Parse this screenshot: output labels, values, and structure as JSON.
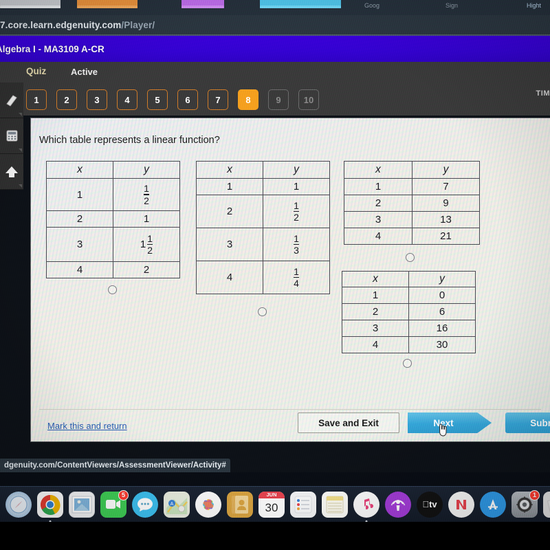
{
  "browser": {
    "url_bold": "7.core.learn.edgenuity.com",
    "url_dim": "/Player/",
    "status_url": "dgenuity.com/ContentViewers/AssessmentViewer/Activity#",
    "tabs": [
      {
        "name": "tab-1",
        "color": "#c9ccd1"
      },
      {
        "name": "tab-2",
        "color": "#e8913c"
      },
      {
        "name": "tab-3",
        "color": "#bc6ce8"
      },
      {
        "name": "tab-4",
        "color": "#4fc3e8"
      }
    ],
    "right_tab_labels": [
      "Goog",
      "Sign",
      "Hight"
    ]
  },
  "course": {
    "title": "Algebra I - MA3109 A-CR"
  },
  "nav": {
    "quiz_label": "Quiz",
    "status_label": "Active",
    "timer_label": "TIM",
    "questions": [
      {
        "label": "1",
        "state": "visited"
      },
      {
        "label": "2",
        "state": "visited"
      },
      {
        "label": "3",
        "state": "visited"
      },
      {
        "label": "4",
        "state": "visited"
      },
      {
        "label": "5",
        "state": "visited"
      },
      {
        "label": "6",
        "state": "visited"
      },
      {
        "label": "7",
        "state": "visited"
      },
      {
        "label": "8",
        "state": "current"
      },
      {
        "label": "9",
        "state": "locked"
      },
      {
        "label": "10",
        "state": "locked"
      }
    ]
  },
  "rail": [
    {
      "name": "eraser-icon",
      "glyph": "╱"
    },
    {
      "name": "calculator-icon",
      "glyph": "▦"
    },
    {
      "name": "arrow-up-icon",
      "glyph": "↑"
    }
  ],
  "question": {
    "prompt": "Which table represents a linear function?",
    "options": [
      {
        "id": "option-a",
        "headers": [
          "x",
          "y"
        ],
        "rows": [
          {
            "x": "1",
            "y_type": "fraction",
            "y_num": "1",
            "y_den": "2"
          },
          {
            "x": "2",
            "y_type": "plain",
            "y": "1"
          },
          {
            "x": "3",
            "y_type": "mixed",
            "y_whole": "1",
            "y_num": "1",
            "y_den": "2"
          },
          {
            "x": "4",
            "y_type": "plain",
            "y": "2"
          }
        ]
      },
      {
        "id": "option-b",
        "headers": [
          "x",
          "y"
        ],
        "rows": [
          {
            "x": "1",
            "y_type": "plain",
            "y": "1"
          },
          {
            "x": "2",
            "y_type": "fraction",
            "y_num": "1",
            "y_den": "2"
          },
          {
            "x": "3",
            "y_type": "fraction",
            "y_num": "1",
            "y_den": "3"
          },
          {
            "x": "4",
            "y_type": "fraction",
            "y_num": "1",
            "y_den": "4"
          }
        ]
      },
      {
        "id": "option-c",
        "headers": [
          "x",
          "y"
        ],
        "rows": [
          {
            "x": "1",
            "y_type": "plain",
            "y": "7"
          },
          {
            "x": "2",
            "y_type": "plain",
            "y": "9"
          },
          {
            "x": "3",
            "y_type": "plain",
            "y": "13"
          },
          {
            "x": "4",
            "y_type": "plain",
            "y": "21"
          }
        ]
      },
      {
        "id": "option-d",
        "headers": [
          "x",
          "y"
        ],
        "rows": [
          {
            "x": "1",
            "y_type": "plain",
            "y": "0"
          },
          {
            "x": "2",
            "y_type": "plain",
            "y": "6"
          },
          {
            "x": "3",
            "y_type": "plain",
            "y": "16"
          },
          {
            "x": "4",
            "y_type": "plain",
            "y": "30"
          }
        ]
      }
    ]
  },
  "footer": {
    "mark_link": "Mark this and return",
    "save_label": "Save and Exit",
    "next_label": "Next",
    "submit_label": "Subm"
  },
  "dock": [
    {
      "name": "safari-icon",
      "label": "⦿",
      "bg": "#dfe7ef",
      "fg": "#2f7fd1",
      "round": true,
      "badge": "",
      "dot": false
    },
    {
      "name": "chrome-icon",
      "label": "◉",
      "bg": "#f7f7f7",
      "fg": "#2f7fd1",
      "round": false,
      "badge": "",
      "dot": true
    },
    {
      "name": "mail-icon",
      "label": "✉",
      "bg": "#e9edf2",
      "fg": "#5a7fa8",
      "round": false,
      "badge": "",
      "dot": false
    },
    {
      "name": "facetime-icon",
      "label": "▢",
      "bg": "#3fcc55",
      "fg": "#ffffff",
      "round": false,
      "badge": "5",
      "dot": false
    },
    {
      "name": "messages-icon",
      "label": "●●●",
      "bg": "#3dc0f0",
      "fg": "#ffffff",
      "round": true,
      "badge": "",
      "dot": false
    },
    {
      "name": "maps-icon",
      "label": "A",
      "bg": "#e8eadf",
      "fg": "#3b82d6",
      "round": false,
      "badge": "",
      "dot": false
    },
    {
      "name": "photos-icon",
      "label": "✹",
      "bg": "#fbfbfb",
      "fg": "#e8568a",
      "round": true,
      "badge": "",
      "dot": false
    },
    {
      "name": "contacts-icon",
      "label": "○",
      "bg": "#d9a441",
      "fg": "#f5e0b0",
      "round": false,
      "badge": "",
      "dot": false
    },
    {
      "name": "calendar-icon",
      "label": "30",
      "bg": "#ffffff",
      "fg": "#2b2b2b",
      "round": false,
      "badge": "",
      "dot": false,
      "sublabel": "JUN"
    },
    {
      "name": "reminders-icon",
      "label": "≡",
      "bg": "#f4f5f7",
      "fg": "#6b7280",
      "round": false,
      "badge": "",
      "dot": false
    },
    {
      "name": "notes-icon",
      "label": "≡",
      "bg": "#f6e7a8",
      "fg": "#8a7a3a",
      "round": false,
      "badge": "",
      "dot": false
    },
    {
      "name": "music-icon",
      "label": "♫",
      "bg": "#fafafa",
      "fg": "#e8437a",
      "round": true,
      "badge": "",
      "dot": true
    },
    {
      "name": "podcasts-icon",
      "label": "ⓘ",
      "bg": "#a23cd6",
      "fg": "#ffffff",
      "round": true,
      "badge": "",
      "dot": false
    },
    {
      "name": "appletv-icon",
      "label": "tv",
      "bg": "#111111",
      "fg": "#ffffff",
      "round": true,
      "badge": "",
      "dot": false
    },
    {
      "name": "news-icon",
      "label": "N",
      "bg": "#f7f7f7",
      "fg": "#e8434f",
      "round": true,
      "badge": "",
      "dot": false
    },
    {
      "name": "appstore-icon",
      "label": "A",
      "bg": "#2f9ae8",
      "fg": "#ffffff",
      "round": true,
      "badge": "",
      "dot": false
    },
    {
      "name": "system-preferences-icon",
      "label": "⚙",
      "bg": "#9aa0a6",
      "fg": "#ffffff",
      "round": false,
      "badge": "1",
      "dot": false
    },
    {
      "name": "roblox-icon",
      "label": "▪",
      "bg": "#e8e8e8",
      "fg": "#2b2b2b",
      "round": false,
      "badge": "",
      "dot": false
    }
  ]
}
